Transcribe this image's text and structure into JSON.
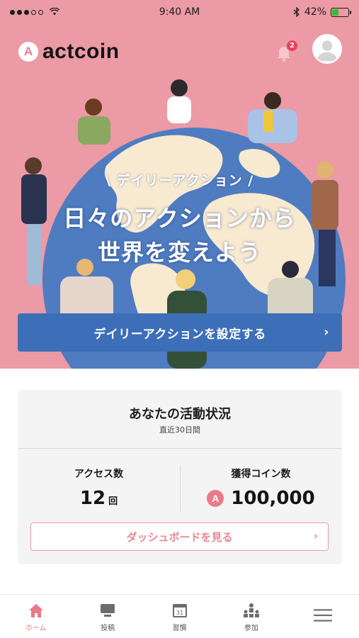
{
  "status_bar": {
    "time": "9:40 AM",
    "battery_percent": "42%",
    "battery_level": 0.42
  },
  "header": {
    "app_name": "actcoin",
    "logo_mark": "A",
    "notification_count": "2"
  },
  "hero": {
    "tag": "\\ デイリーアクション /",
    "title_line1": "日々のアクションから",
    "title_line2": "世界を変えよう",
    "cta_label": "デイリーアクションを設定する",
    "cta_chevron": "›"
  },
  "activity": {
    "title": "あなたの活動状況",
    "subtitle": "直近30日間",
    "access_label": "アクセス数",
    "access_value": "12",
    "access_unit": "回",
    "coin_label": "獲得コイン数",
    "coin_mark": "A",
    "coin_value": "100,000",
    "dashboard_label": "ダッシュボードを見る",
    "dashboard_chevron": "›"
  },
  "tabs": [
    {
      "label": "ホーム",
      "icon": "home-icon",
      "active": true
    },
    {
      "label": "投稿",
      "icon": "post-icon",
      "active": false
    },
    {
      "label": "習慣",
      "icon": "calendar-icon",
      "active": false
    },
    {
      "label": "参加",
      "icon": "join-icon",
      "active": false
    },
    {
      "label": "",
      "icon": "menu-icon",
      "active": false
    }
  ],
  "calendar_icon_text": "31",
  "colors": {
    "brand_pink": "#ec9aa5",
    "cta_blue": "#3d6fb8",
    "accent_pink": "#ec7a8b",
    "badge_red": "#e8425a"
  }
}
